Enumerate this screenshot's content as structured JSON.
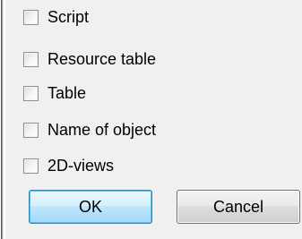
{
  "checkboxes": [
    {
      "label": "Script",
      "checked": false
    },
    {
      "label": "Resource table",
      "checked": false
    },
    {
      "label": "Table",
      "checked": false
    },
    {
      "label": "Name of object",
      "checked": false
    },
    {
      "label": "2D-views",
      "checked": false
    }
  ],
  "buttons": {
    "ok_label": "OK",
    "cancel_label": "Cancel"
  },
  "colors": {
    "dialog_background": "#f0f0f0",
    "ok_border": "#3c7fb1",
    "cancel_border": "#707070"
  }
}
